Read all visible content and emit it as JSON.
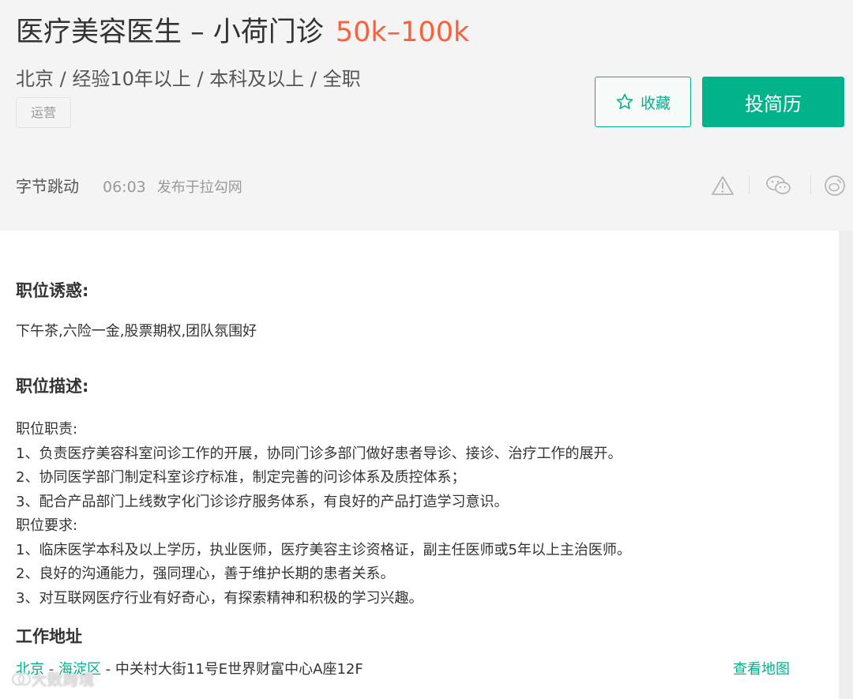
{
  "job": {
    "title": "医疗美容医生 – 小荷门诊",
    "salary": "50k–100k",
    "meta": "北京 / 经验10年以上 / 本科及以上 / 全职",
    "tag": "运营"
  },
  "actions": {
    "collect_label": "收藏",
    "apply_label": "投简历"
  },
  "company": {
    "name": "字节跳动",
    "time": "06:03",
    "source": "发布于拉勾网"
  },
  "perks": {
    "heading": "职位诱惑:",
    "text": "下午茶,六险一金,股票期权,团队氛围好"
  },
  "description": {
    "heading": "职位描述:",
    "lines": [
      "职位职责:",
      "1、负责医疗美容科室问诊工作的开展，协同门诊多部门做好患者导诊、接诊、治疗工作的展开。",
      "2、协同医学部门制定科室诊疗标准，制定完善的问诊体系及质控体系；",
      "3、配合产品部门上线数字化门诊诊疗服务体系，有良好的产品打造学习意识。",
      "职位要求:",
      "1、临床医学本科及以上学历，执业医师，医疗美容主诊资格证，副主任医师或5年以上主治医师。",
      "2、良好的沟通能力，强同理心，善于维护长期的患者关系。",
      "3、对互联网医疗行业有好奇心，有探索精神和积极的学习兴趣。"
    ]
  },
  "address": {
    "heading": "工作地址",
    "city": "北京",
    "district": "海淀区",
    "separator": " - ",
    "detail": " - 中关村大街11号E世界财富中心A座12F",
    "map_link": "查看地图"
  },
  "watermark": "大数跨境",
  "colors": {
    "accent": "#00b38a",
    "salary": "#fd5f39"
  },
  "icons": [
    "star-icon",
    "warning-icon",
    "wechat-icon",
    "weibo-icon"
  ]
}
